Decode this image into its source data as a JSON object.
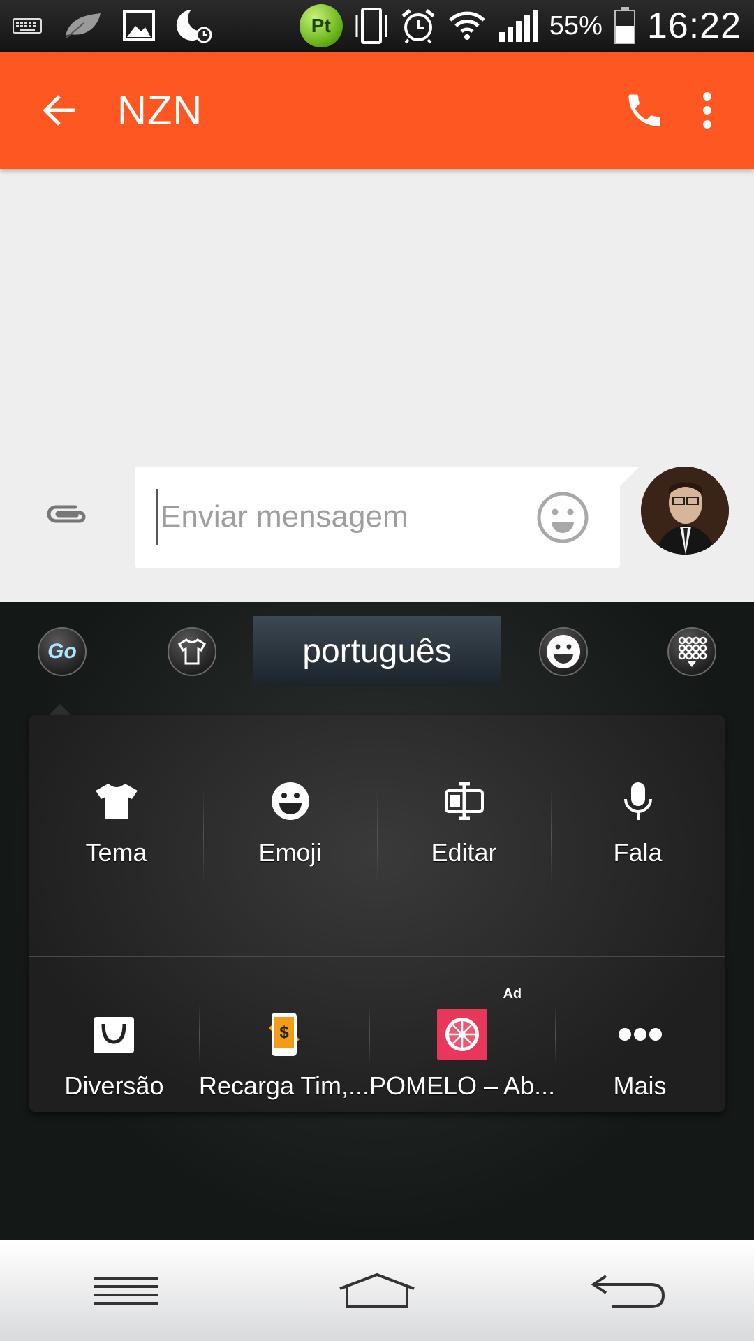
{
  "status_bar": {
    "battery": "55%",
    "time": "16:22",
    "pt_badge": "Pt",
    "icons": [
      "keyboard-icon",
      "leaf-icon",
      "image-icon",
      "moon-clock-icon",
      "vibrate-icon",
      "alarm-icon",
      "wifi-icon",
      "signal-icon",
      "battery-icon"
    ]
  },
  "app_bar": {
    "title": "NZN",
    "icons": [
      "back-arrow-icon",
      "phone-icon",
      "overflow-menu-icon"
    ],
    "color": "#ff5722"
  },
  "compose": {
    "placeholder": "Enviar mensagem",
    "value": ""
  },
  "keyboard": {
    "go_label": "Go",
    "language": "português",
    "panel_row1": [
      {
        "label": "Tema",
        "icon": "tshirt-icon"
      },
      {
        "label": "Emoji",
        "icon": "emoji-icon"
      },
      {
        "label": "Editar",
        "icon": "edit-cursor-icon"
      },
      {
        "label": "Fala",
        "icon": "microphone-icon"
      }
    ],
    "panel_row2": [
      {
        "label": "Diversão",
        "icon": "shopping-bag-icon"
      },
      {
        "label": "Recarga Tim,...",
        "icon": "recharge-phone-icon"
      },
      {
        "label": "POMELO – Ab...",
        "icon": "pomelo-icon",
        "ad": "Ad"
      },
      {
        "label": "Mais",
        "icon": "more-dots-icon"
      }
    ]
  },
  "nav_bar": {
    "icons": [
      "menu-icon",
      "home-icon",
      "back-icon"
    ]
  }
}
